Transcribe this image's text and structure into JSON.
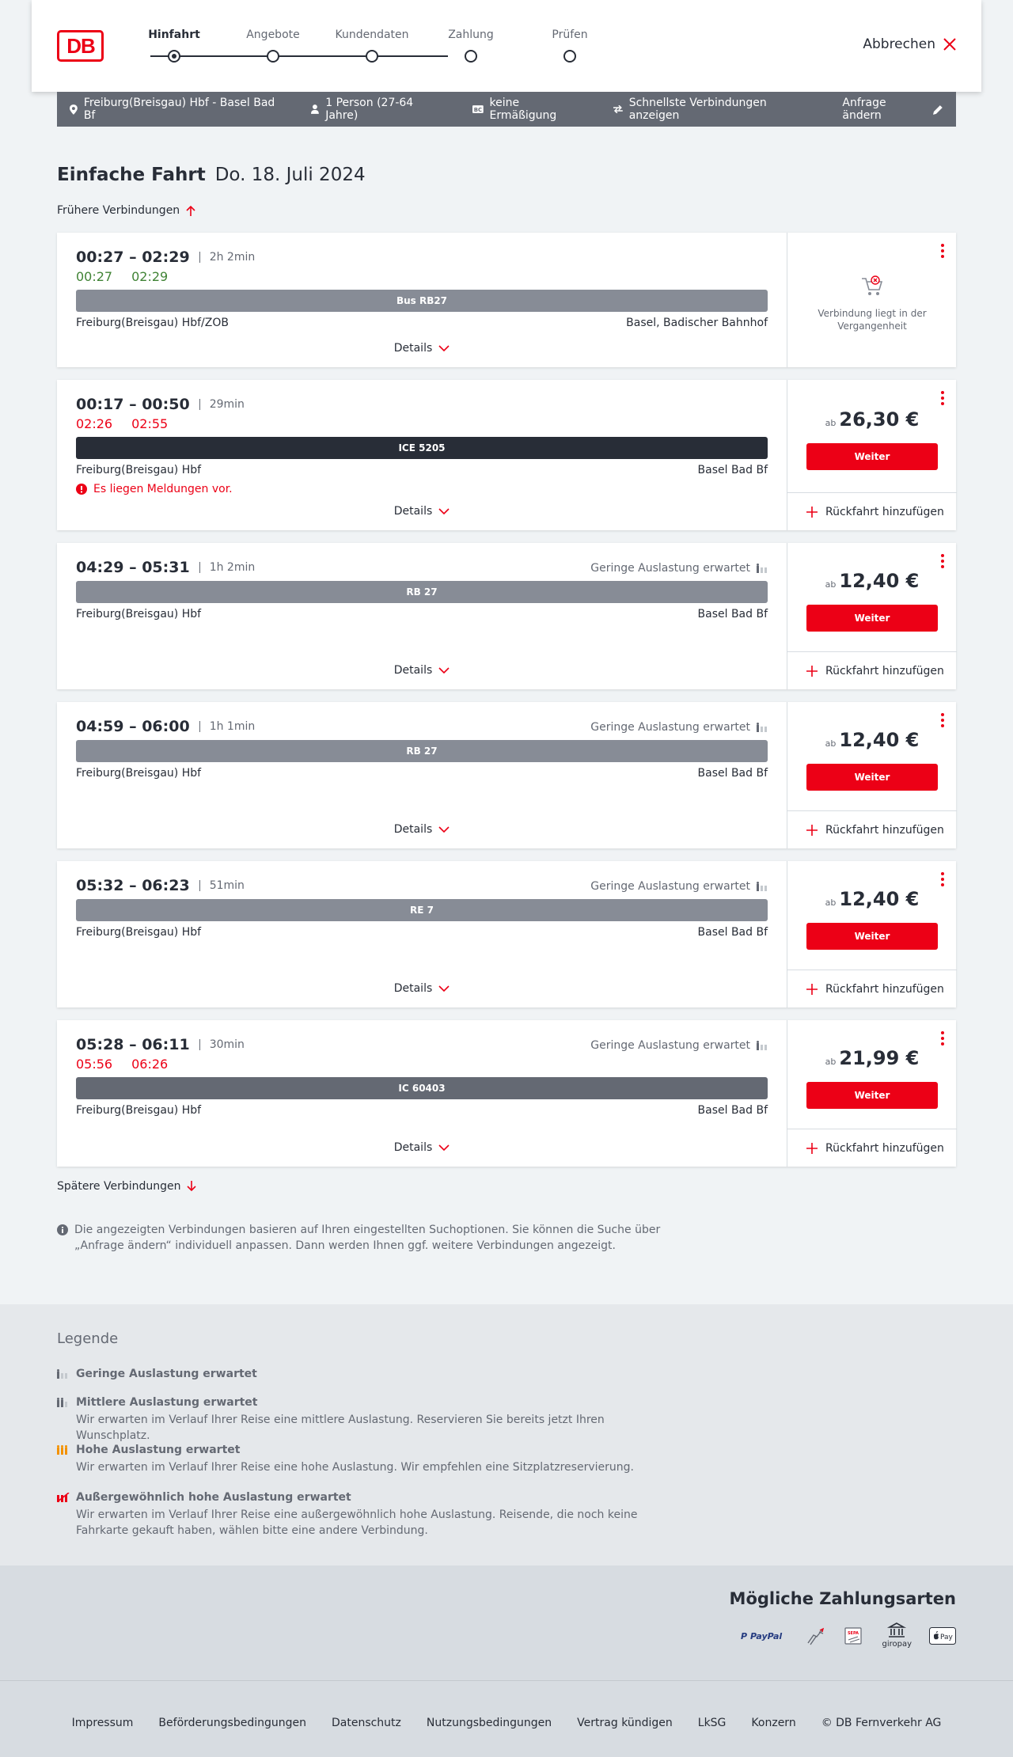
{
  "header": {
    "steps": [
      {
        "label": "Hinfahrt"
      },
      {
        "label": "Angebote"
      },
      {
        "label": "Kundendaten"
      },
      {
        "label": "Zahlung"
      },
      {
        "label": "Prüfen"
      }
    ],
    "cancel_label": "Abbrechen"
  },
  "searchbar": {
    "route": "Freiburg(Breisgau) Hbf - Basel Bad Bf",
    "passengers": "1 Person (27-64 Jahre)",
    "discount": "keine Ermäßigung",
    "fastest": "Schnellste Verbindungen anzeigen",
    "change": "Anfrage ändern"
  },
  "main": {
    "title": "Einfache Fahrt",
    "date": "Do. 18. Juli 2024",
    "earlier": "Frühere Verbindungen",
    "later": "Spätere Verbindungen",
    "details_label": "Details",
    "weiter_label": "Weiter",
    "return_label": "Rückfahrt hinzufügen",
    "price_prefix": "ab",
    "past_label": "Verbindung liegt in der Vergangenheit",
    "info": "Die angezeigten Verbindungen basieren auf Ihren eingestellten Suchoptionen. Sie können die Suche über „Anfrage ändern“ individuell anpassen. Dann werden Ihnen ggf. weitere Verbindungen angezeigt."
  },
  "connections": [
    {
      "times": "00:27 – 02:29",
      "duration": "2h 2min",
      "rt_dep": "00:27",
      "rt_arr": "02:29",
      "train": "Bus RB27",
      "from": "Freiburg(Breisgau) Hbf/ZOB",
      "to": "Basel, Badischer Bahnhof"
    },
    {
      "times": "00:17 – 00:50",
      "duration": "29min",
      "rt_dep": "02:26",
      "rt_arr": "02:55",
      "train": "ICE 5205",
      "from": "Freiburg(Breisgau) Hbf",
      "to": "Basel Bad Bf",
      "message": "Es liegen Meldungen vor.",
      "price": "26,30 €"
    },
    {
      "times": "04:29 – 05:31",
      "duration": "1h 2min",
      "load": "Geringe Auslastung erwartet",
      "train": "RB 27",
      "from": "Freiburg(Breisgau) Hbf",
      "to": "Basel Bad Bf",
      "price": "12,40 €"
    },
    {
      "times": "04:59 – 06:00",
      "duration": "1h 1min",
      "load": "Geringe Auslastung erwartet",
      "train": "RB 27",
      "from": "Freiburg(Breisgau) Hbf",
      "to": "Basel Bad Bf",
      "price": "12,40 €"
    },
    {
      "times": "05:32 – 06:23",
      "duration": "51min",
      "load": "Geringe Auslastung erwartet",
      "train": "RE 7",
      "from": "Freiburg(Breisgau) Hbf",
      "to": "Basel Bad Bf",
      "price": "12,40 €"
    },
    {
      "times": "05:28 – 06:11",
      "duration": "30min",
      "load": "Geringe Auslastung erwartet",
      "rt_dep": "05:56",
      "rt_arr": "06:26",
      "train": "IC 60403",
      "from": "Freiburg(Breisgau) Hbf",
      "to": "Basel Bad Bf",
      "price": "21,99 €"
    }
  ],
  "legend": {
    "title": "Legende",
    "items": [
      {
        "title": "Geringe Auslastung erwartet",
        "desc": ""
      },
      {
        "title": "Mittlere Auslastung erwartet",
        "desc": "Wir erwarten im Verlauf Ihrer Reise eine mittlere Auslastung. Reservieren Sie bereits jetzt Ihren Wunschplatz."
      },
      {
        "title": "Hohe Auslastung erwartet",
        "desc": "Wir erwarten im Verlauf Ihrer Reise eine hohe Auslastung. Wir empfehlen eine Sitzplatzreservierung."
      },
      {
        "title": "Außergewöhnlich hohe Auslastung erwartet",
        "desc": "Wir erwarten im Verlauf Ihrer Reise eine außergewöhnlich hohe Auslastung. Reisende, die noch keine Fahrkarte gekauft haben, wählen bitte eine andere Verbindung."
      }
    ]
  },
  "payment": {
    "title": "Mögliche Zahlungsarten",
    "paypal": "PayPal",
    "sepa": "SEPA",
    "giropay": "giropay",
    "applepay": "Pay"
  },
  "footer": {
    "links": [
      "Impressum",
      "Beförderungsbedingungen",
      "Datenschutz",
      "Nutzungsbedingungen",
      "Vertrag kündigen",
      "LkSG",
      "Konzern",
      "© DB Fernverkehr AG"
    ]
  },
  "colors": {
    "brand": "#ec0016",
    "text": "#282d37",
    "muted": "#646973",
    "ok": "#408335"
  }
}
